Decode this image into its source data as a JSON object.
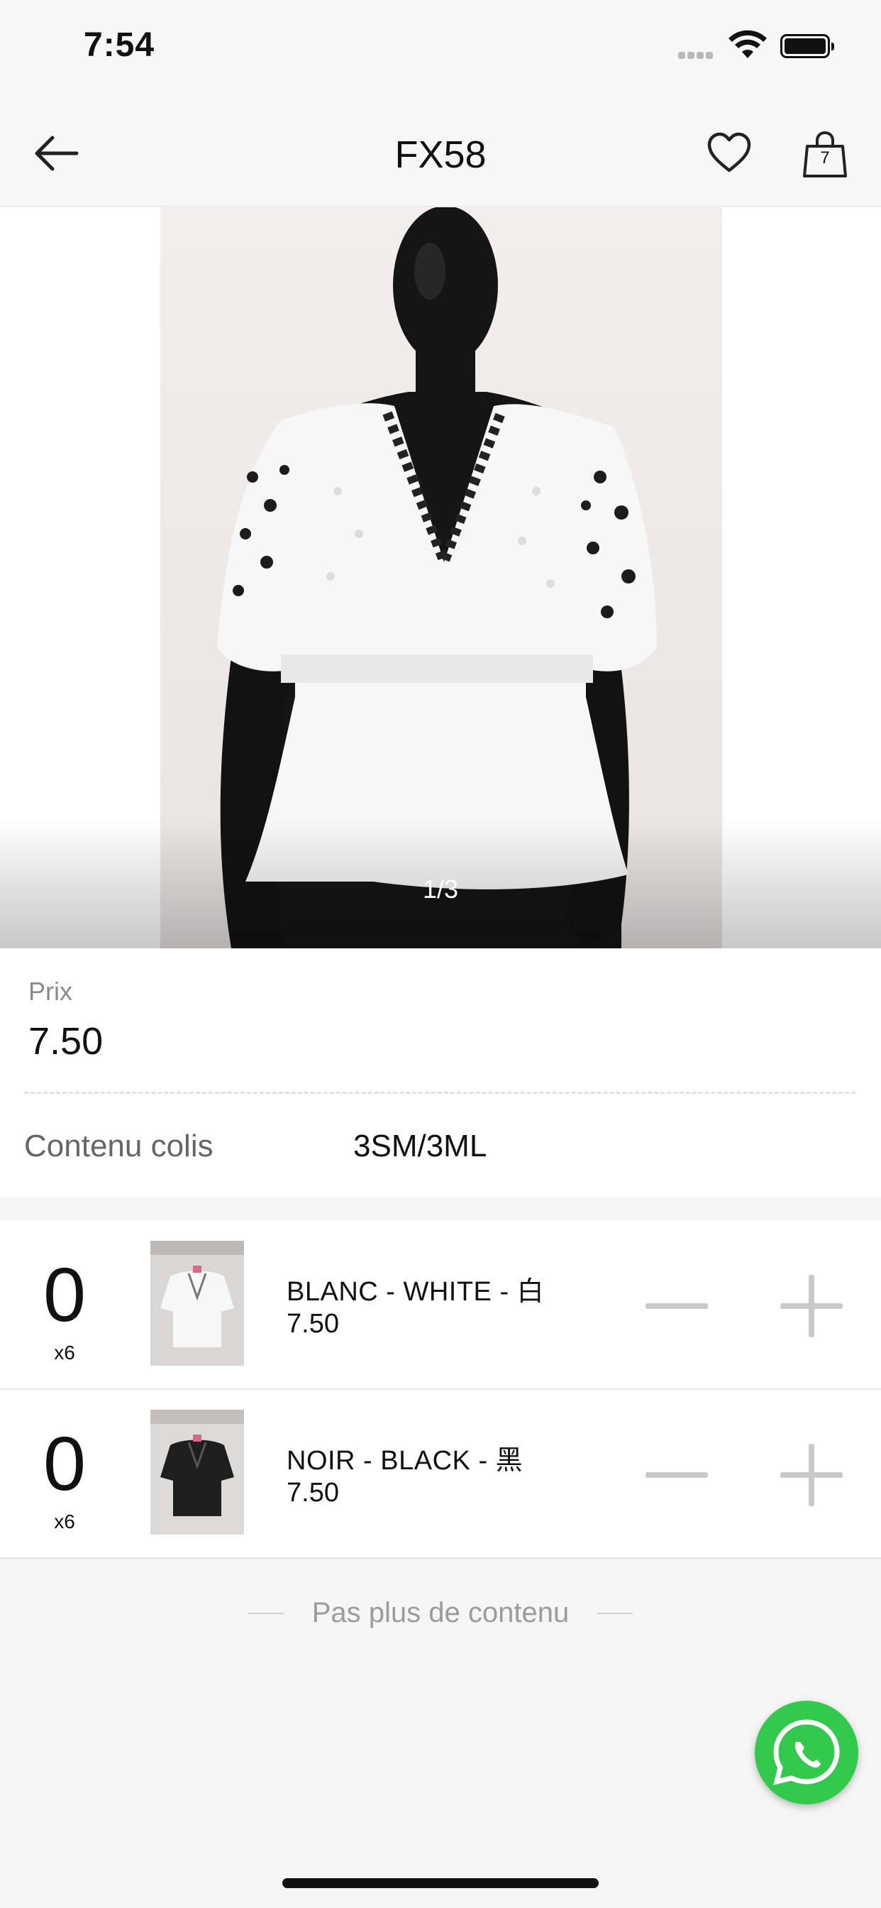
{
  "status_bar": {
    "time": "7:54"
  },
  "nav": {
    "title": "FX58",
    "cart_count": "7"
  },
  "gallery": {
    "counter": "1/3"
  },
  "product": {
    "price_label": "Prix",
    "price": "7.50",
    "package_label": "Contenu colis",
    "package_value": "3SM/3ML"
  },
  "variants": [
    {
      "qty": "0",
      "multiplier": "x6",
      "name": "BLANC - WHITE - 白",
      "price": "7.50",
      "color": "#f2f2f2"
    },
    {
      "qty": "0",
      "multiplier": "x6",
      "name": "NOIR - BLACK - 黑",
      "price": "7.50",
      "color": "#1c1c1c"
    }
  ],
  "footer": {
    "end_text": "Pas plus de contenu"
  },
  "colors": {
    "whatsapp": "#33c94d",
    "background": "#f5f5f5"
  }
}
